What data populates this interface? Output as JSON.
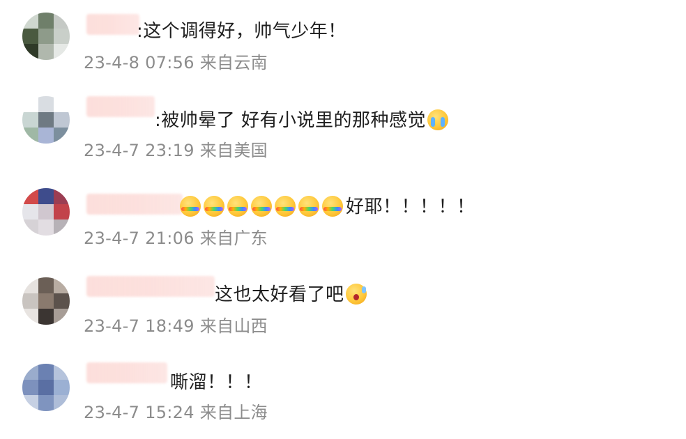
{
  "comments": [
    {
      "text": ":这个调得好，帅气少年！",
      "time": "23-4-8 07:56",
      "location": "来自云南",
      "emoji": [],
      "avatar_colors": [
        "#cfd7cf",
        "#6f7f6a",
        "#c5c9c5",
        "#4a5a40",
        "#8e9b8a",
        "#c9cfc9",
        "#2f3a28",
        "#b0b8ad",
        "#e5e8e5"
      ]
    },
    {
      "text": ":被帅晕了 好有小说里的那种感觉",
      "time": "23-4-7 23:19",
      "location": "来自美国",
      "emoji": [
        "cry-face-icon"
      ],
      "avatar_colors": [
        "#ffffff",
        "#d9dde2",
        "#ffffff",
        "#c9d6d3",
        "#6f7a83",
        "#bfc7d3",
        "#9fb8a5",
        "#a9b5d6",
        "#7c8f9e"
      ]
    },
    {
      "text": "好耶！！！！！",
      "time": "23-4-7 21:06",
      "location": "来自广东",
      "emoji": [
        "rainbow-face-icon",
        "rainbow-face-icon",
        "rainbow-face-icon",
        "rainbow-face-icon",
        "rainbow-face-icon",
        "rainbow-face-icon",
        "rainbow-face-icon"
      ],
      "avatar_colors": [
        "#d24a4a",
        "#3e4c8c",
        "#9b3d52",
        "#e5e5ea",
        "#d0c7cf",
        "#c2424a",
        "#d6d2d6",
        "#e2dde2",
        "#b7b2b7"
      ]
    },
    {
      "text": "这也太好看了吧",
      "time": "23-4-7 18:49",
      "location": "来自山西",
      "emoji": [
        "shocked-face-icon"
      ],
      "avatar_colors": [
        "#e6e2df",
        "#6b5f56",
        "#b8aca2",
        "#c9c4c0",
        "#8a7a6e",
        "#5c524c",
        "#e8e4e1",
        "#3b3532",
        "#a79d96"
      ]
    },
    {
      "text": "嘶溜！！！",
      "time": "23-4-7 15:24",
      "location": "来自上海",
      "emoji": [],
      "avatar_colors": [
        "#9aaccc",
        "#6b81b2",
        "#b5c3dc",
        "#7d91bd",
        "#5a6fa3",
        "#9bb0d3",
        "#c6d0e3",
        "#7f94bf",
        "#aebdd8"
      ]
    }
  ]
}
